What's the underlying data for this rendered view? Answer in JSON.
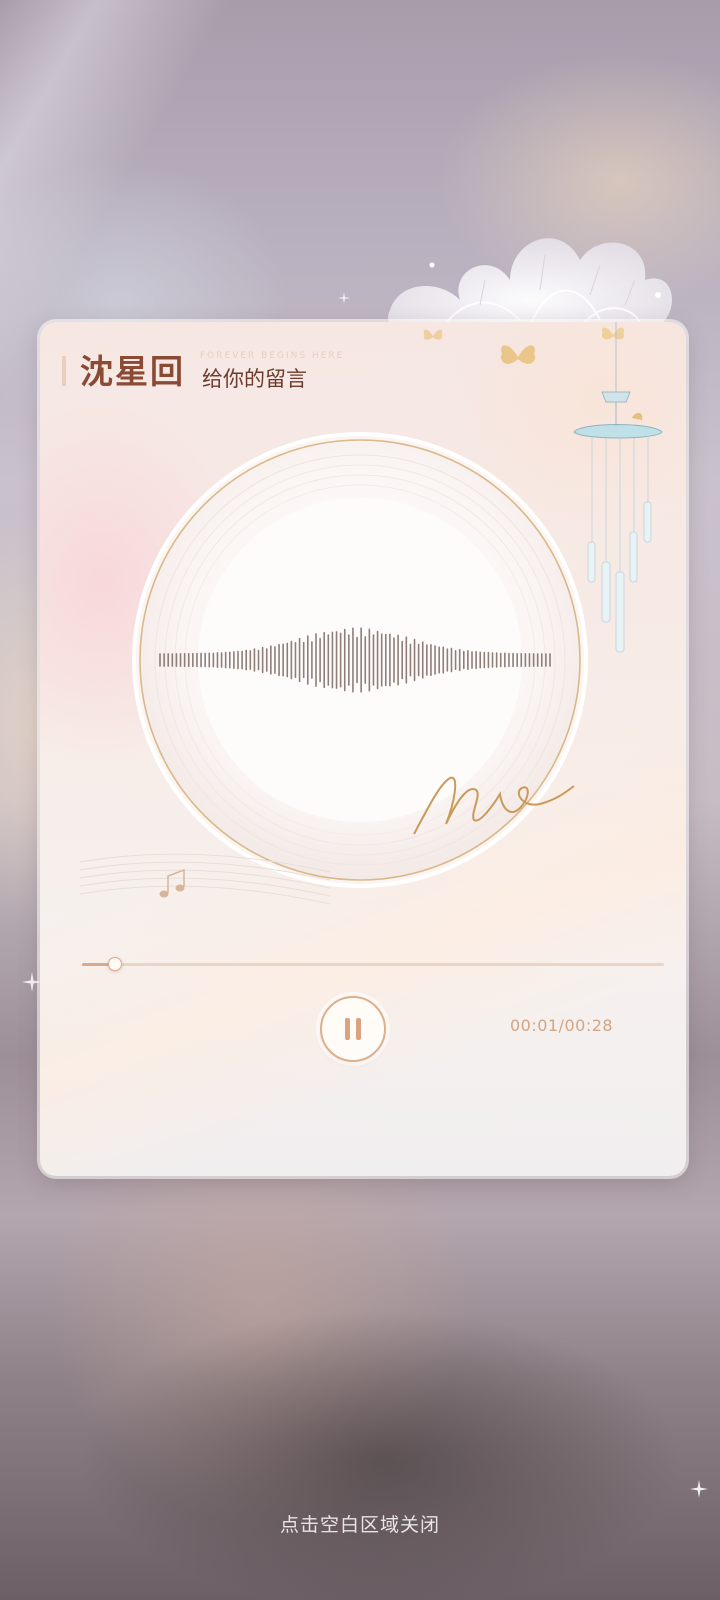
{
  "card": {
    "title_name": "沈星回",
    "title_sub": "给你的留言",
    "title_en": "FOREVER BEGINS HERE"
  },
  "player": {
    "progress_fraction": 0.056,
    "elapsed": "00:01",
    "total": "00:28",
    "time_readout": "00:01/00:28",
    "state": "playing",
    "control_icon": "pause-icon",
    "accent_color": "#d9a47f"
  },
  "footer": {
    "close_hint": "点击空白区域关闭"
  }
}
